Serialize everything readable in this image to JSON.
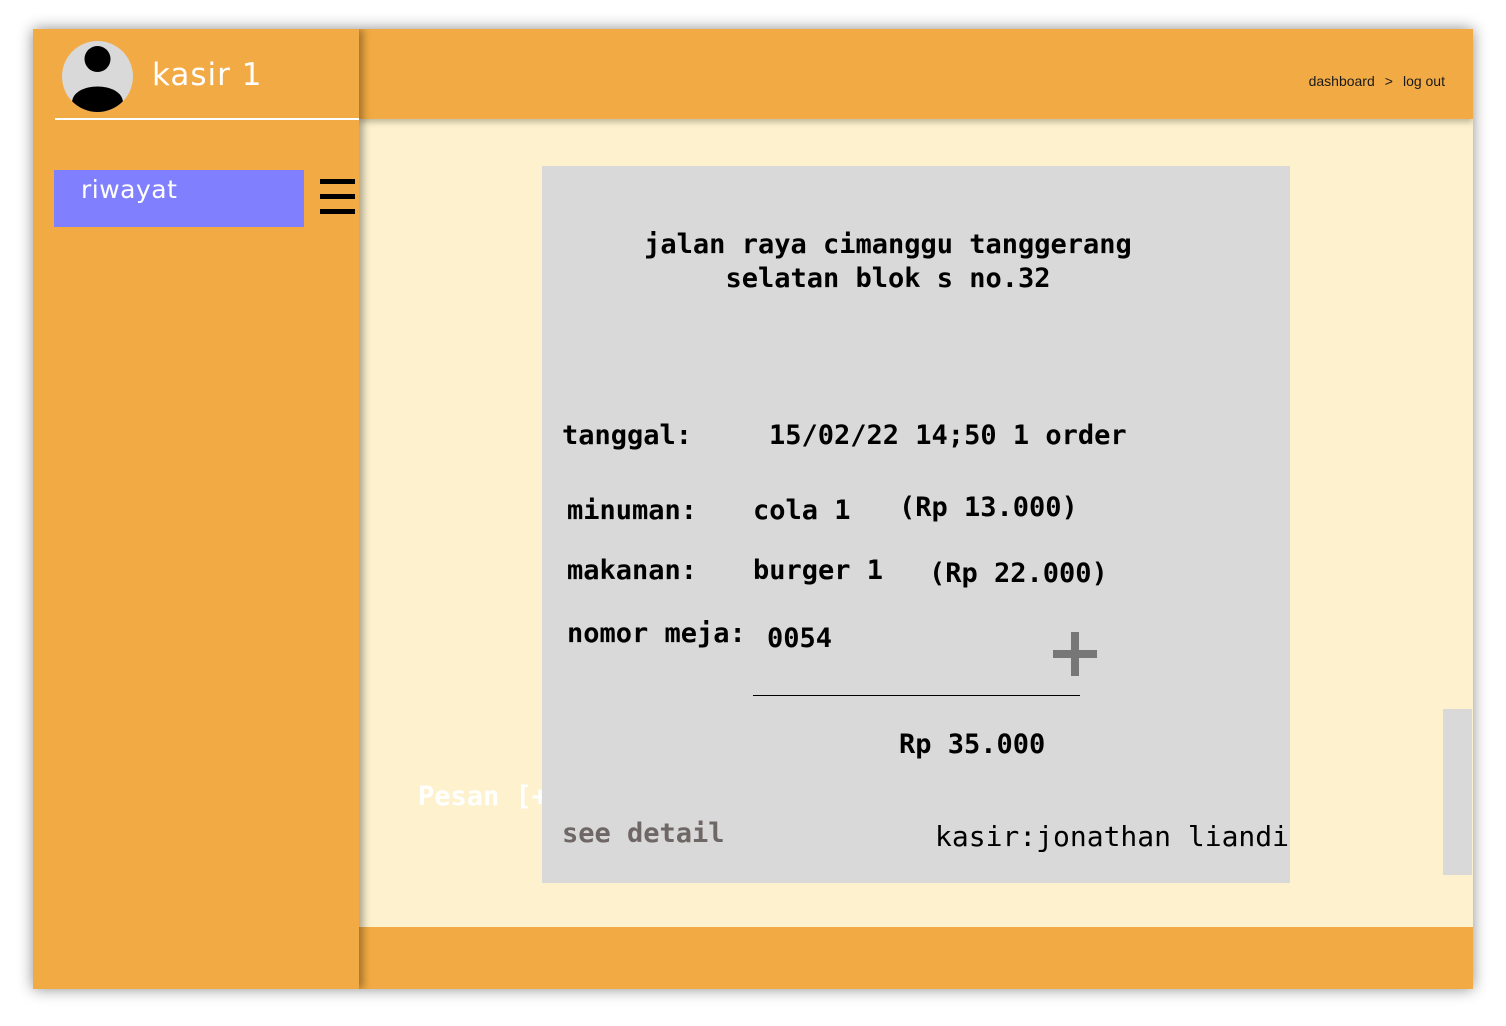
{
  "sidebar": {
    "user_name": "kasir 1",
    "nav": {
      "riwayat": "riwayat"
    }
  },
  "header": {
    "breadcrumb": {
      "dashboard": "dashboard",
      "separator": ">",
      "logout": "log out"
    }
  },
  "content": {
    "pesan_label": "Pesan [+",
    "receipt": {
      "address_line1": "jalan raya cimanggu tanggerang",
      "address_line2": "selatan blok s no.32",
      "tanggal_label": "tanggal:",
      "tanggal_value": "15/02/22 14;50 1 order",
      "minuman_label": "minuman:",
      "minuman_item": "cola 1",
      "minuman_price": "(Rp 13.000)",
      "makanan_label": "makanan:",
      "makanan_item": "burger 1",
      "makanan_price": "(Rp 22.000)",
      "meja_label": "nomor meja:",
      "meja_value": "0054",
      "total": "Rp 35.000",
      "see_detail": "see detail",
      "kasir": "kasir:jonathan liandi"
    }
  },
  "colors": {
    "accent_orange": "#f2ab44",
    "content_bg": "#fef2ce",
    "nav_active": "#8080ff",
    "receipt_bg": "#d9d9d9"
  },
  "icons": [
    "user-avatar-icon",
    "hamburger-menu-icon",
    "plus-icon"
  ]
}
